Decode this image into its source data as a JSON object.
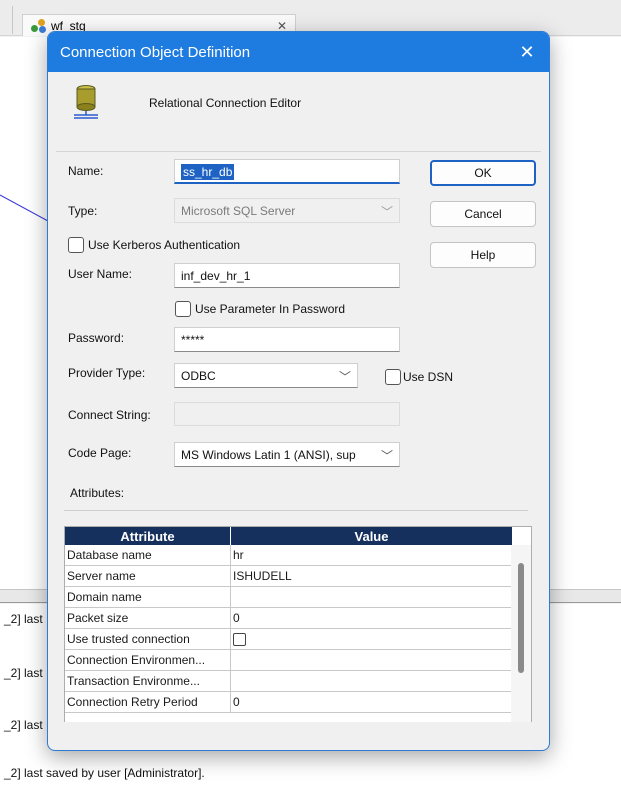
{
  "background": {
    "tab_title": "wf_stg",
    "log_prefix": "_2] last",
    "log_full": "_2] last saved by user [Administrator]."
  },
  "dialog": {
    "title": "Connection Object Definition",
    "close_glyph": "✕",
    "editor_label": "Relational Connection Editor",
    "fields": {
      "name_label": "Name:",
      "name_value": "ss_hr_db",
      "type_label": "Type:",
      "type_value": "Microsoft SQL Server",
      "kerberos_label": "Use Kerberos Authentication",
      "username_label": "User Name:",
      "username_value": "inf_dev_hr_1",
      "param_password_label": "Use Parameter In Password",
      "password_label": "Password:",
      "password_value": "*****",
      "provider_label": "Provider Type:",
      "provider_value": "ODBC",
      "use_dsn_label": "Use DSN",
      "connect_string_label": "Connect String:",
      "connect_string_value": "",
      "codepage_label": "Code Page:",
      "codepage_value": "MS Windows Latin 1 (ANSI), sup",
      "attributes_label": "Attributes:"
    },
    "buttons": {
      "ok": "OK",
      "cancel": "Cancel",
      "help": "Help"
    },
    "grid": {
      "col_attribute": "Attribute",
      "col_value": "Value",
      "rows": [
        {
          "attribute": "Database name",
          "value": "hr"
        },
        {
          "attribute": "Server name",
          "value": "ISHUDELL"
        },
        {
          "attribute": "Domain name",
          "value": ""
        },
        {
          "attribute": "Packet size",
          "value": "0"
        },
        {
          "attribute": "Use trusted connection",
          "value": ""
        },
        {
          "attribute": "Connection Environmen...",
          "value": ""
        },
        {
          "attribute": "Transaction Environme...",
          "value": ""
        },
        {
          "attribute": "Connection Retry Period",
          "value": "0"
        }
      ]
    }
  },
  "colors": {
    "titlebar": "#1e7be0",
    "grid_header": "#16305e",
    "focus": "#1e63c4"
  }
}
